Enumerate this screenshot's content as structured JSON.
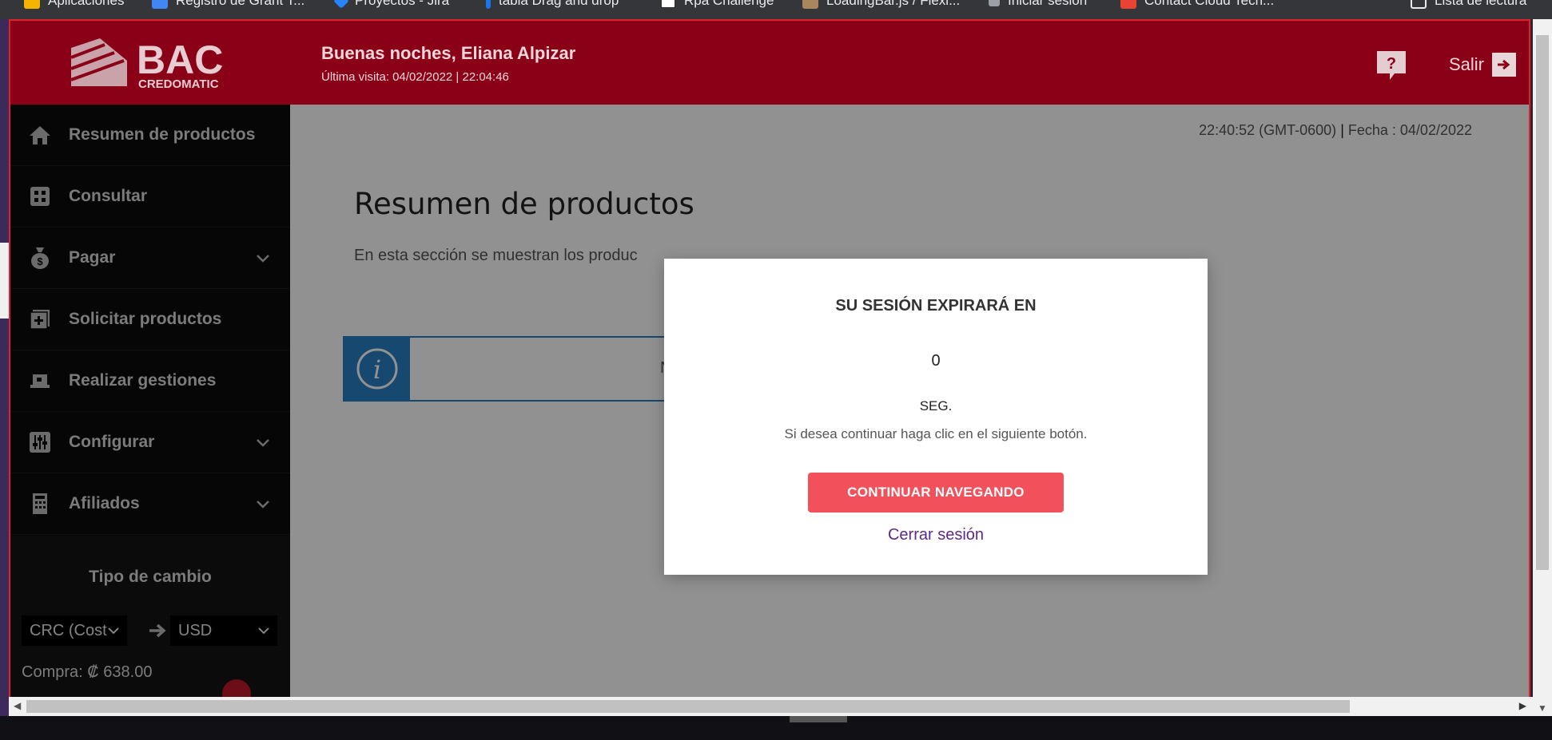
{
  "bookmarks": [
    {
      "label": "Aplicaciones",
      "color": "#f4b400"
    },
    {
      "label": "Registro de Grant T...",
      "color": "#4285f4"
    },
    {
      "label": "Proyectos - Jira",
      "color": "#2684ff"
    },
    {
      "label": "tabla Drag and drop",
      "color": "#1a73e8"
    },
    {
      "label": "Rpa Challenge",
      "color": "#ffffff"
    },
    {
      "label": "LoadingBar.js / Flexi...",
      "color": "#a88660"
    },
    {
      "label": "Iniciar sesión",
      "color": "#9aa0a6"
    },
    {
      "label": "Contact Cloud Tech...",
      "color": "#ea4335"
    },
    {
      "label": "Lista de lectura",
      "color": "#e8eaed"
    }
  ],
  "header": {
    "logo_text": "BAC",
    "logo_sub": "CREDOMATIC",
    "greeting": "Buenas noches, Eliana Alpizar",
    "last_visit": "Última visita:  04/02/2022 | 22:04:46",
    "help_icon": "question-bubble-icon",
    "logout_label": "Salir",
    "brand_color": "#8a0017"
  },
  "sidebar": {
    "items": [
      {
        "label": "Resumen de productos",
        "icon": "home-icon",
        "has_chevron": false
      },
      {
        "label": "Consultar",
        "icon": "grid-icon",
        "has_chevron": false
      },
      {
        "label": "Pagar",
        "icon": "money-bag-icon",
        "has_chevron": true
      },
      {
        "label": "Solicitar productos",
        "icon": "add-document-icon",
        "has_chevron": false
      },
      {
        "label": "Realizar gestiones",
        "icon": "laptop-icon",
        "has_chevron": false
      },
      {
        "label": "Configurar",
        "icon": "sliders-icon",
        "has_chevron": true
      },
      {
        "label": "Afiliados",
        "icon": "building-icon",
        "has_chevron": true
      }
    ],
    "exchange": {
      "title": "Tipo de cambio",
      "from_currency": "CRC (Cost",
      "to_currency": "USD",
      "buy_label": "Compra:",
      "buy_value": "₡ 638.00"
    }
  },
  "main": {
    "clock": "22:40:52 (GMT-0600)",
    "date_label": "Fecha : 04/02/2022",
    "title": "Resumen de productos",
    "description": "En esta sección se muestran los produc",
    "info_text": "N",
    "accent_color": "#2a7fc4"
  },
  "modal": {
    "title": "SU SESIÓN EXPIRARÁ EN",
    "countdown": "0",
    "unit": "SEG.",
    "info": "Si desea continuar haga clic en el siguiente botón.",
    "continue_label": "CONTINUAR NAVEGANDO",
    "logout_link": "Cerrar sesión",
    "button_color": "#f2505a"
  }
}
